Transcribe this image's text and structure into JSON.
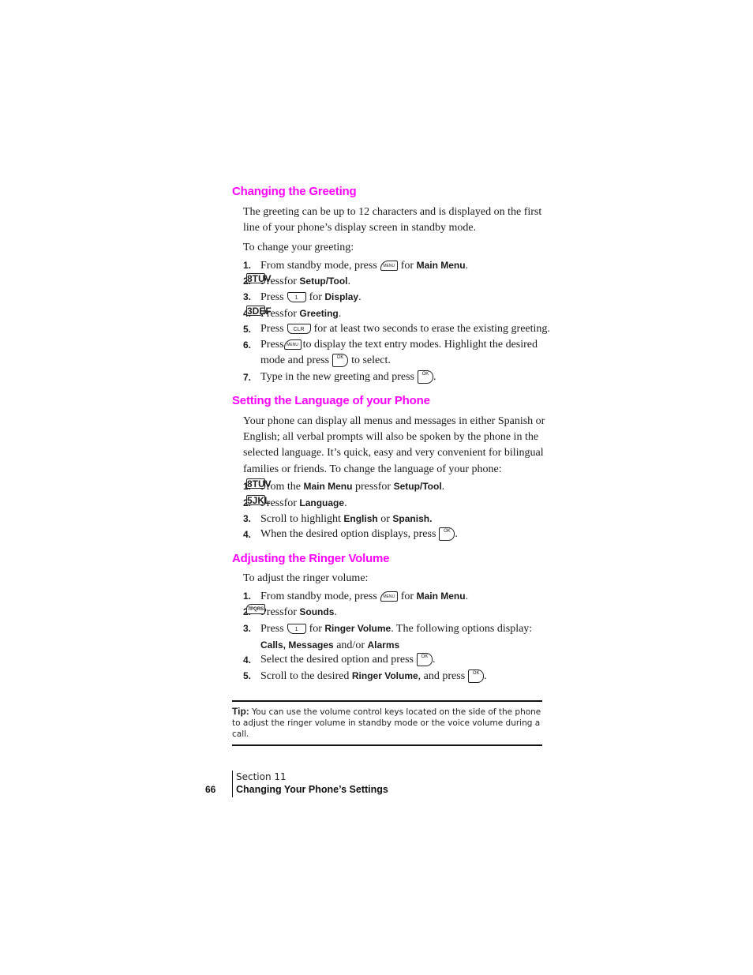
{
  "sections": [
    {
      "heading": "Changing the Greeting",
      "intro": "The greeting can be up to 12 characters and is displayed on the first line of your phone’s display screen in standby mode.",
      "lead": "To change your greeting:",
      "steps": [
        {
          "num": "1.",
          "pre": "From standby mode, press",
          "key": "MENU",
          "mid": "for",
          "bold": "Main Menu",
          "post": "."
        },
        {
          "num": "2.",
          "pre": "Press",
          "key": "8TUV",
          "mid": "for",
          "bold": "Setup/Tool",
          "post": "."
        },
        {
          "num": "3.",
          "pre": "Press",
          "key": "1",
          "mid": "for",
          "bold": "Display",
          "post": "."
        },
        {
          "num": "4.",
          "pre": "Press",
          "key": "3DEF",
          "mid": "for",
          "bold": "Greeting",
          "post": "."
        },
        {
          "num": "5.",
          "pre": "Press",
          "key": "CLR",
          "mid": "for at least two seconds to erase the existing greeting.",
          "bold": "",
          "post": ""
        },
        {
          "num": "6.",
          "pre": "Press",
          "key": "MENU",
          "mid": "to display the text entry modes. Highlight the desired mode and press",
          "key2": "OK",
          "post": "to select."
        },
        {
          "num": "7.",
          "pre": "Type in the new greeting and press",
          "key": "OK",
          "post": "."
        }
      ]
    },
    {
      "heading": "Setting the Language of your Phone",
      "intro": "Your phone can display all menus and messages in either Spanish or English; all verbal prompts will also be spoken by the phone in the selected language. It’s quick, easy and very convenient for bilingual families or friends. To change the language of your phone:",
      "steps": [
        {
          "num": "1.",
          "pre": "From the",
          "bold1": "Main Menu",
          "mid": "press",
          "key": "8TUV",
          "mid2": "for",
          "bold": "Setup/Tool",
          "post": "."
        },
        {
          "num": "2.",
          "pre": "Press",
          "key": "5JKL",
          "mid": "for",
          "bold": "Language",
          "post": "."
        },
        {
          "num": "3.",
          "pre": "Scroll to highlight",
          "bold1": "English",
          "mid": "or",
          "bold": "Spanish.",
          "post": ""
        },
        {
          "num": "4.",
          "pre": "When the desired option displays, press",
          "key": "OK",
          "post": "."
        }
      ]
    },
    {
      "heading": "Adjusting the Ringer Volume",
      "lead": "To adjust the ringer volume:",
      "steps": [
        {
          "num": "1.",
          "pre": "From standby mode, press",
          "key": "MENU",
          "mid": "for",
          "bold": "Main Menu",
          "post": "."
        },
        {
          "num": "2.",
          "pre": "Press",
          "key": "7PQRS",
          "mid": "for",
          "bold": "Sounds",
          "post": "."
        },
        {
          "num": "3.",
          "pre": "Press",
          "key": "1",
          "mid": "for",
          "bold": "Ringer Volume",
          "mid2": ". The following options display:",
          "bold2": "Calls, Messages",
          "mid3": "and/or",
          "bold3": "Alarms"
        },
        {
          "num": "4.",
          "pre": "Select the desired option and press",
          "key": "OK",
          "post": "."
        },
        {
          "num": "5.",
          "pre": "Scroll to the desired",
          "bold1": "Ringer Volume",
          "mid": ", and press",
          "key": "OK",
          "post": "."
        }
      ]
    }
  ],
  "tip": {
    "label": "Tip:",
    "text": "You can use the volume control keys located on the side of the phone to adjust the ringer volume in standby mode or the voice volume during a call."
  },
  "footer": {
    "page_number": "66",
    "section": "Section 11",
    "title": "Changing Your Phone’s Settings"
  }
}
